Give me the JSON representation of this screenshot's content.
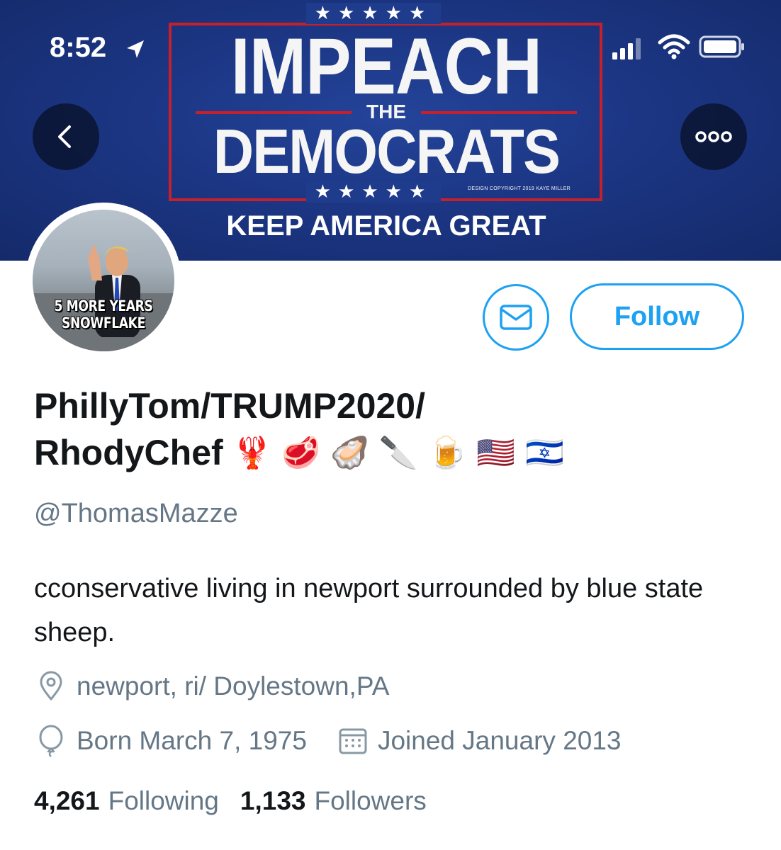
{
  "status_bar": {
    "time": "8:52"
  },
  "banner": {
    "stars_top": "★★★★★",
    "line1": "IMPEACH",
    "line2": "THE",
    "line3": "DEMOCRATS",
    "stars_bottom": "★★★★★",
    "copyright": "DESIGN COPYRIGHT 2019 KAYE MILLER",
    "tagline": "KEEP AMERICA GREAT"
  },
  "avatar": {
    "caption_line1": "5 MORE YEARS",
    "caption_line2": "SNOWFLAKE"
  },
  "actions": {
    "follow_label": "Follow"
  },
  "profile": {
    "display_name_line1": "PhillyTom/TRUMP2020/",
    "display_name_line2": "RhodyChef",
    "display_name_emoji": "🦞 🥩 🦪 🔪 🍺 🇺🇸 🇮🇱",
    "handle": "@ThomasMazze",
    "bio": "cconservative living in newport surrounded by blue state sheep.",
    "location": "newport, ri/ Doylestown,PA",
    "birthday": "Born March 7, 1975",
    "joined": "Joined January 2013",
    "following_count": "4,261",
    "following_label": "Following",
    "followers_count": "1,133",
    "followers_label": "Followers"
  },
  "icons": {
    "back": "chevron-left-icon",
    "more": "more-horizontal-icon",
    "message": "envelope-icon",
    "location": "map-pin-icon",
    "birthday": "balloon-icon",
    "joined": "calendar-icon"
  },
  "colors": {
    "accent": "#1da1f2",
    "banner_blue": "#1c3684",
    "banner_red": "#c8202a",
    "secondary_text": "#657786",
    "primary_text": "#14171a"
  }
}
